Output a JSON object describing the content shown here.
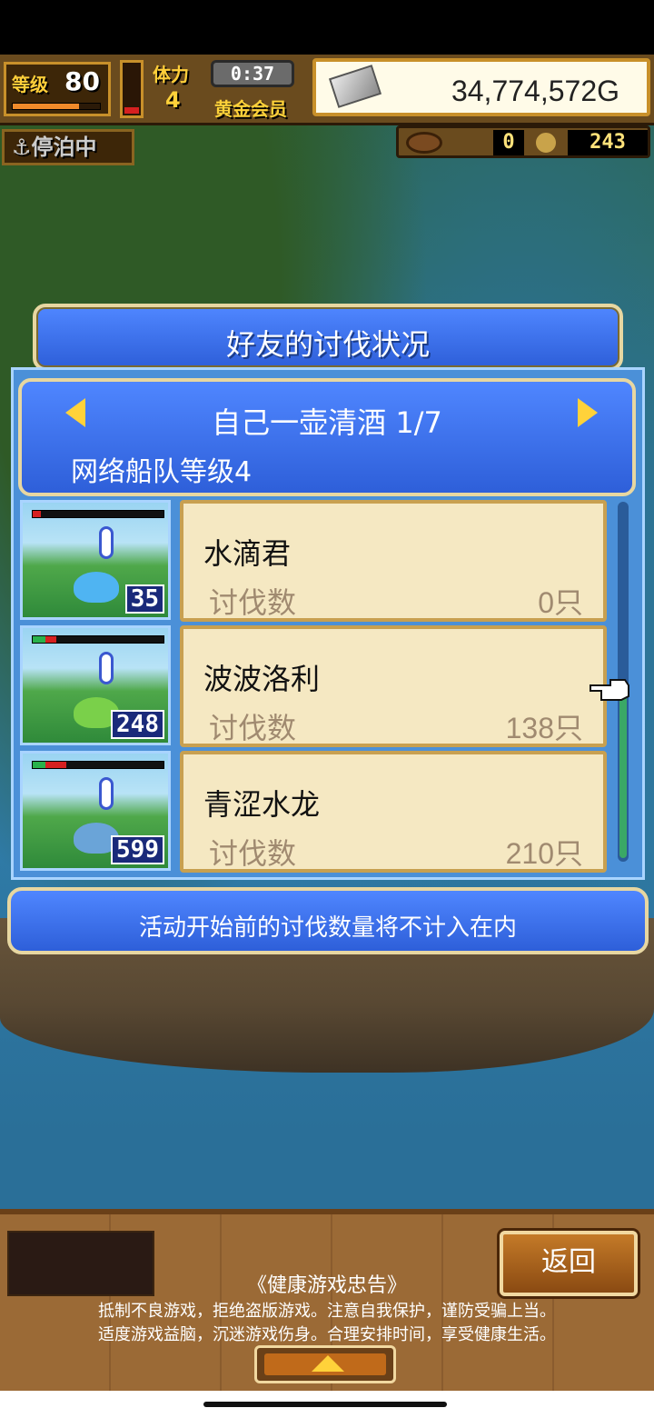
{
  "hud": {
    "level_label": "等级",
    "level_value": "80",
    "level_progress": 0.76,
    "stamina_gauge_level": 0.12,
    "stamina_label": "体力",
    "stamina_value": "4",
    "timer": "0:37",
    "membership": "黄金会员",
    "money": "34,774,572G",
    "status": "停泊中",
    "resource_1": "0",
    "resource_2": "243"
  },
  "dialog": {
    "title": "好友的讨伐状况",
    "friend_name": "自己一壶清酒 1/7",
    "fleet_level": "网络船队等级4",
    "notice": "活动开始前的讨伐数量将不计入在内",
    "rows": [
      {
        "name": "水滴君",
        "kill_label": "讨伐数",
        "kill_value": "0只",
        "count": "35",
        "monster_color": "#4fb4f2",
        "hp_green": 0.0,
        "hp_red": 0.06
      },
      {
        "name": "波波洛利",
        "kill_label": "讨伐数",
        "kill_value": "138只",
        "count": "248",
        "monster_color": "#7ad04a",
        "hp_green": 0.1,
        "hp_red": 0.18
      },
      {
        "name": "青涩水龙",
        "kill_label": "讨伐数",
        "kill_value": "210只",
        "count": "599",
        "monster_color": "#6aa4d8",
        "hp_green": 0.1,
        "hp_red": 0.26
      }
    ]
  },
  "bottom": {
    "back_label": "返回",
    "health_title": "《健康游戏忠告》",
    "health_line_1": "抵制不良游戏，拒绝盗版游戏。注意自我保护，谨防受骗上当。",
    "health_line_2": "适度游戏益脑，沉迷游戏伤身。合理安排时间，享受健康生活。"
  },
  "colors": {
    "dialog_blue": "#2e5fd9",
    "card_bg": "#f5e8c2",
    "accent_gold": "#ffd23a"
  },
  "icons": [
    "silver-ingot-icon",
    "anchor-icon",
    "barrel-icon",
    "coin-icon",
    "arrow-left-icon",
    "arrow-right-icon",
    "pointer-hand-icon",
    "alert-icon",
    "up-triangle-icon"
  ]
}
